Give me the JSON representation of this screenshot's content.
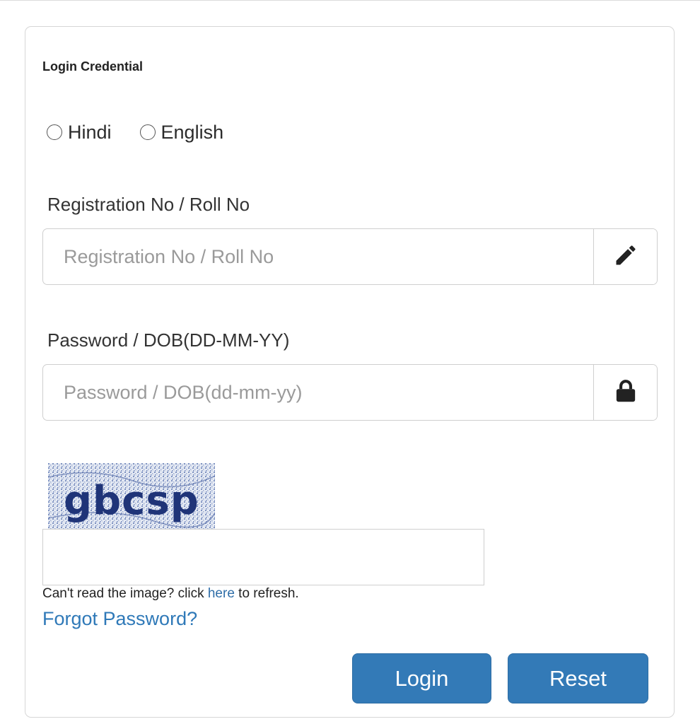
{
  "form": {
    "title": "Login Credential",
    "language_options": [
      "Hindi",
      "English"
    ],
    "registration": {
      "label": "Registration No / Roll No",
      "placeholder": "Registration No / Roll No",
      "value": "",
      "icon": "pencil-icon"
    },
    "password": {
      "label": "Password / DOB(DD-MM-YY)",
      "placeholder": "Password / DOB(dd-mm-yy)",
      "value": "",
      "icon": "lock-icon"
    },
    "captcha": {
      "image_text": "gbcsp",
      "input_value": "",
      "refresh_prefix": "Can't read the image? click",
      "refresh_link": "here",
      "refresh_suffix": "to refresh."
    },
    "forgot_password": "Forgot Password?",
    "buttons": {
      "login": "Login",
      "reset": "Reset"
    }
  },
  "colors": {
    "primary_button": "#337ab7",
    "link": "#2f79b8",
    "border": "#cfcfcf"
  }
}
